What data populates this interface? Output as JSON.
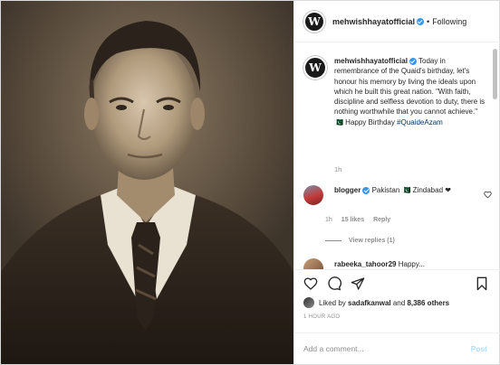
{
  "post": {
    "author": {
      "username": "mehwishhayatofficial",
      "avatar_letter": "W",
      "verified": true,
      "follow_status": "Following",
      "separator": "•"
    },
    "caption": {
      "text": "Today in remembrance of the Quaid's birthday, let's honour his memory by living the ideals upon which he built this great nation. \"With faith, discipline and selfless devotion to duty, there is nothing worthwhile that you cannot achieve.\" 🇵🇰 Happy Birthday ",
      "hashtag": "#QuaideAzam",
      "time": "1h"
    },
    "comments": [
      {
        "username": "blogger",
        "verified": true,
        "text": "Pakistan 🇵🇰 Zindabad ❤",
        "time": "1h",
        "likes": "15 likes",
        "reply_label": "Reply",
        "view_replies": "View replies (1)"
      },
      {
        "username": "rabeeka_tahoor29",
        "text": "Happy..."
      }
    ],
    "likes": {
      "prefix": "Liked by",
      "user": "sadafkanwal",
      "connector": "and",
      "count": "8,386 others"
    },
    "timestamp": "1 HOUR AGO",
    "add_comment_placeholder": "Add a comment...",
    "post_button": "Post"
  },
  "icons": [
    "heart-icon",
    "comment-icon",
    "share-icon",
    "bookmark-icon",
    "verified-icon"
  ],
  "colors": {
    "verified": "#3897f0",
    "link": "#00376b",
    "muted": "#8e8e8e",
    "post_button": "#b2dffc"
  }
}
